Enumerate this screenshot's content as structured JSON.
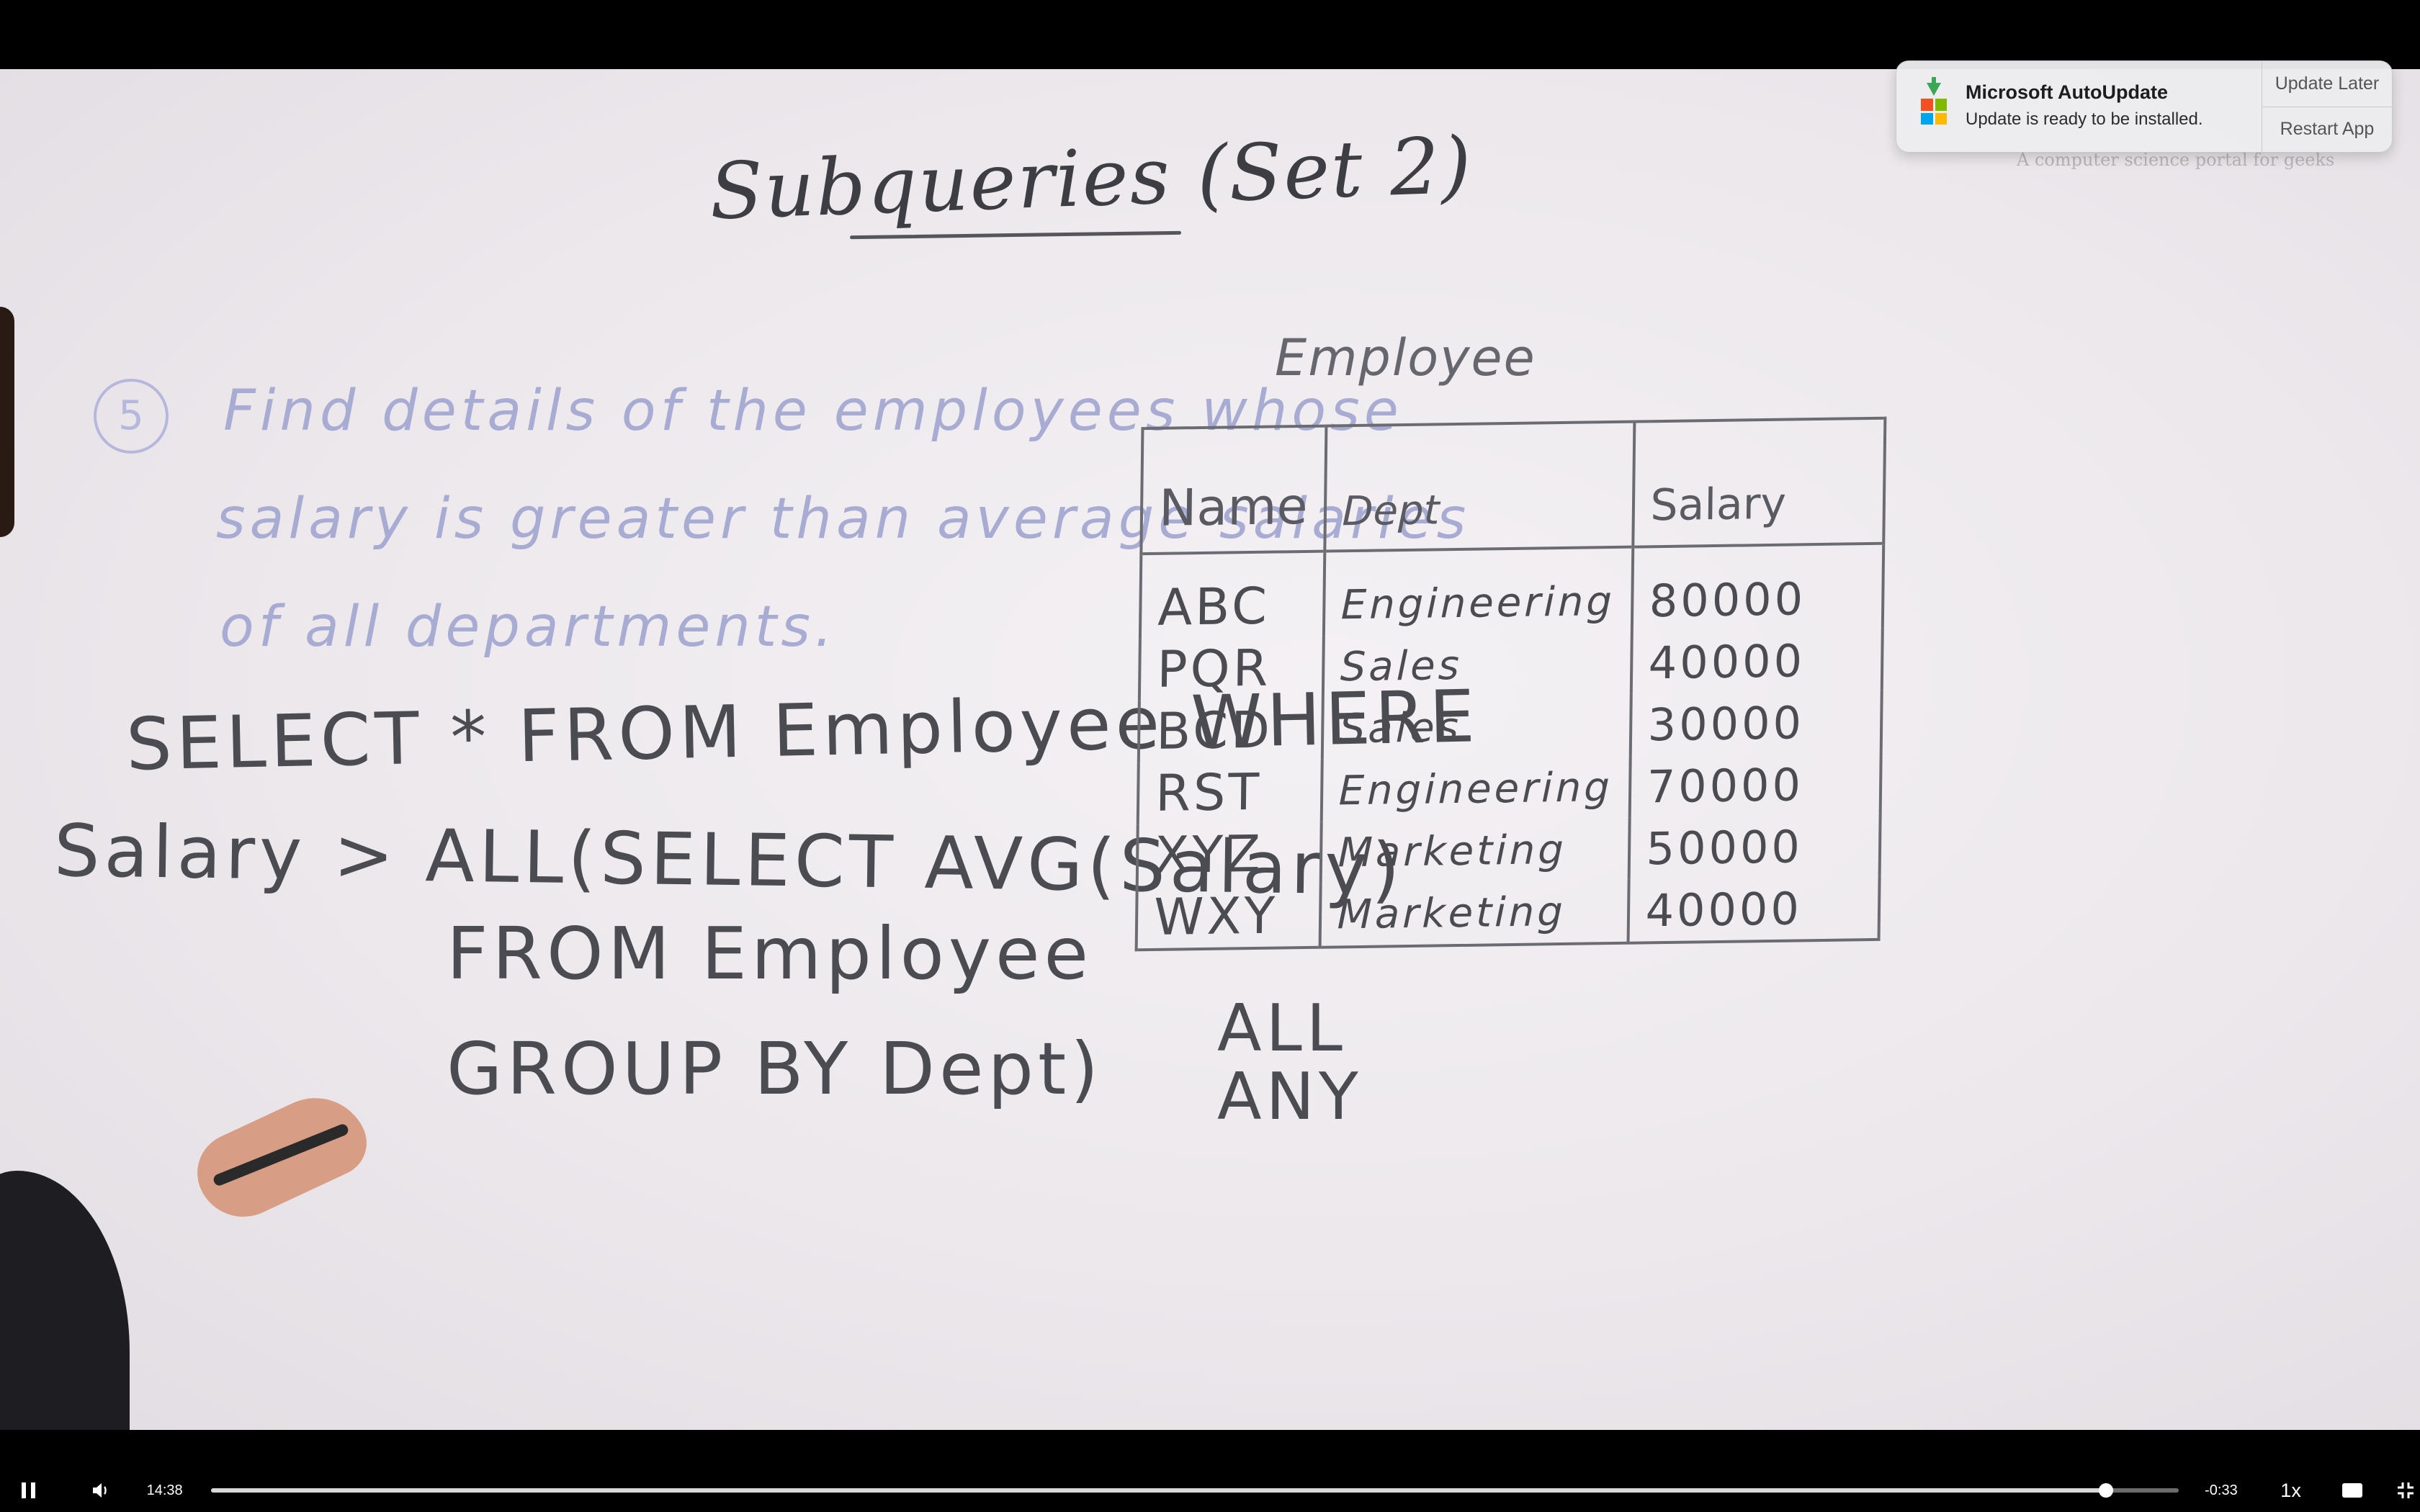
{
  "whiteboard": {
    "title": "Subqueries (Set 2)",
    "watermark": "A computer science portal for geeks",
    "question_number": "5",
    "question_lines": [
      "Find details of the employees whose",
      "salary is greater than average salaries",
      "of all departments."
    ],
    "sql_lines": [
      "SELECT * FROM Employee WHERE",
      "Salary > ALL(SELECT AVG(Salary)",
      "FROM Employee",
      "GROUP BY Dept)"
    ],
    "table_label": "Employee",
    "table": {
      "headers": [
        "Name",
        "Dept",
        "Salary"
      ],
      "rows": [
        [
          "ABC",
          "Engineering",
          "80000"
        ],
        [
          "PQR",
          "Sales",
          "40000"
        ],
        [
          "BCD",
          "Sales",
          "30000"
        ],
        [
          "RST",
          "Engineering",
          "70000"
        ],
        [
          "XYZ",
          "Marketing",
          "50000"
        ],
        [
          "WXY",
          "Marketing",
          "40000"
        ]
      ]
    },
    "notes": [
      "ALL",
      "ANY"
    ]
  },
  "notification": {
    "app": "Microsoft AutoUpdate",
    "message": "Update is ready to be installed.",
    "actions": {
      "later": "Update Later",
      "restart": "Restart App"
    },
    "icon": "microsoft-autoupdate-icon"
  },
  "player": {
    "elapsed": "14:38",
    "remaining": "-0:33",
    "speed": "1x",
    "progress": 0.963,
    "icons": {
      "pause": "pause-icon",
      "volume": "volume-icon",
      "captions": "captions-icon",
      "fullscreen": "exit-fullscreen-icon"
    }
  },
  "colors": {
    "board": "#ece8ec",
    "ink": "#4b4b52",
    "faint_ink": "#a9acd2",
    "controls_bg": "#000000"
  }
}
